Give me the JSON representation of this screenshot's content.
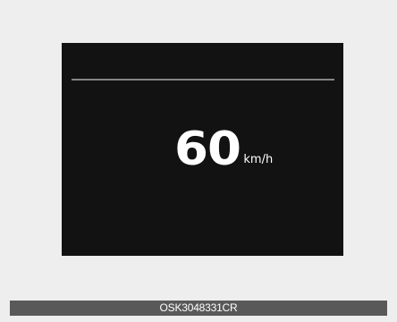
{
  "speed_display": {
    "value": "60",
    "unit": "km/h"
  },
  "caption": {
    "code": "OSK3048331CR"
  },
  "colors": {
    "background": "#eeeeee",
    "display": "#121212",
    "divider": "#858585",
    "caption_bar": "#595959",
    "text": "#ffffff"
  }
}
